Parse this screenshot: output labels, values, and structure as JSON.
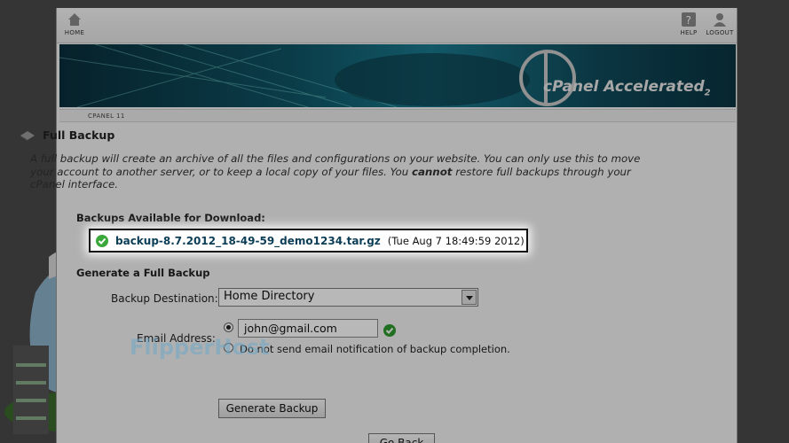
{
  "topbar": {
    "home_label": "HOME",
    "help_label": "HELP",
    "logout_label": "LOGOUT"
  },
  "banner": {
    "logo_text": "cPanel Accelerated",
    "logo_sup": "2"
  },
  "cpanel_version": "CPANEL 11",
  "page": {
    "title": "Full Backup",
    "intro_1": "A full backup will create an archive of all the files and configurations on your website. You can only use this to move your account to another server, or to keep a local copy of your files. You ",
    "intro_bold": "cannot",
    "intro_2": " restore full backups through your cPanel interface."
  },
  "available": {
    "heading": "Backups Available for Download:",
    "file_link": "backup-8.7.2012_18-49-59_demo1234.tar.gz",
    "file_date": "(Tue Aug 7 18:49:59 2012)"
  },
  "generate": {
    "heading": "Generate a Full Backup",
    "destination_label": "Backup Destination:",
    "destination_value": "Home Directory",
    "email_label": "Email Address:",
    "email_value": "john@gmail.com",
    "no_email_label": "Do not send email notification of backup completion.",
    "button_label": "Generate Backup",
    "back_label": "Go Back"
  },
  "watermark": "FlipperHost"
}
